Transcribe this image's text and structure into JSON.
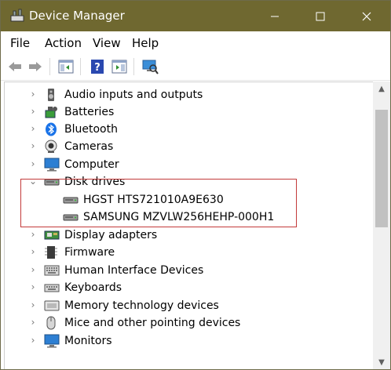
{
  "window": {
    "title": "Device Manager"
  },
  "menu": {
    "file": "File",
    "action": "Action",
    "view": "View",
    "help": "Help"
  },
  "tree": {
    "items": [
      {
        "label": "Audio inputs and outputs",
        "icon": "speaker-icon",
        "expanded": false
      },
      {
        "label": "Batteries",
        "icon": "battery-icon",
        "expanded": false
      },
      {
        "label": "Bluetooth",
        "icon": "bluetooth-icon",
        "expanded": false
      },
      {
        "label": "Cameras",
        "icon": "camera-icon",
        "expanded": false
      },
      {
        "label": "Computer",
        "icon": "monitor-icon",
        "expanded": false
      },
      {
        "label": "Disk drives",
        "icon": "disk-drive-icon",
        "expanded": true,
        "children": [
          {
            "label": "HGST HTS721010A9E630",
            "icon": "disk-drive-icon"
          },
          {
            "label": "SAMSUNG MZVLW256HEHP-000H1",
            "icon": "disk-drive-icon"
          }
        ]
      },
      {
        "label": "Display adapters",
        "icon": "display-adapter-icon",
        "expanded": false
      },
      {
        "label": "Firmware",
        "icon": "chip-icon",
        "expanded": false
      },
      {
        "label": "Human Interface Devices",
        "icon": "keyboard-icon",
        "expanded": false
      },
      {
        "label": "Keyboards",
        "icon": "keyboard-icon",
        "expanded": false
      },
      {
        "label": "Memory technology devices",
        "icon": "memory-card-icon",
        "expanded": false
      },
      {
        "label": "Mice and other pointing devices",
        "icon": "mouse-icon",
        "expanded": false
      },
      {
        "label": "Monitors",
        "icon": "monitor-icon",
        "expanded": false
      }
    ]
  },
  "colors": {
    "titlebar": "#6f6830",
    "highlight_border": "#c33a3a"
  }
}
